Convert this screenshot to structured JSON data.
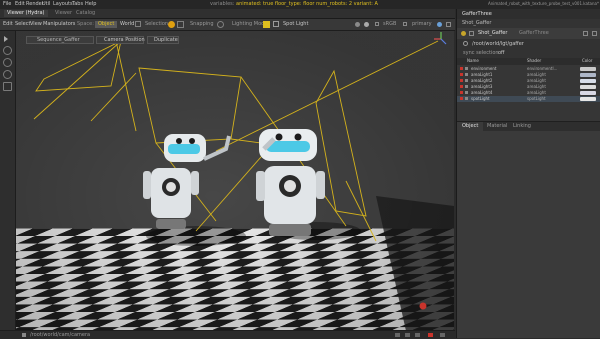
{
  "menubar": {
    "items": [
      "File",
      "Edit",
      "Render",
      "Util",
      "Layouts",
      "Tabs",
      "Help"
    ],
    "status_prefix": "variables:",
    "status_variants": "animated: true  floor_type: floor  num_robots: 2  variant: A",
    "project_file": "Animated_robot_with_texture_probe_test_v001.katana*"
  },
  "tabs": {
    "items": [
      "Viewer (Hydra)",
      "Viewer",
      "Catalog"
    ],
    "active_index": 0
  },
  "toolbar": {
    "items": [
      "Edit",
      "Select",
      "View",
      "Manipulators",
      "Space:"
    ],
    "object_btn": "Object",
    "world_btn": "World",
    "selection_label": "Selection",
    "snapping_label": "Snapping",
    "lighting_label": "Lighting Mode",
    "spot_light": "Spot Light",
    "display_label": "sRGB",
    "camera_label": "primary"
  },
  "viewport_header": {
    "gaffer_field": "Sequence_Gaffer",
    "camera_pos_btn": "Camera Position",
    "duplicate_btn": "Duplicate"
  },
  "status": {
    "camera_path": "/root/world/cam/camera"
  },
  "right_panel": {
    "title": "GafferThree",
    "node_name": "Shot_Gaffer",
    "node_type": "GafferThree",
    "root_path": "/root/world/lgt/gaffer",
    "selection_label": "sync selection",
    "selection_value": "off",
    "columns": [
      "Name",
      "Shader",
      "Color"
    ],
    "rows": [
      {
        "name": "environment",
        "shader": "environmentl...",
        "color": "#c9c9c9"
      },
      {
        "name": "areaLight1",
        "shader": "areaLight",
        "color": "#aeb7c8"
      },
      {
        "name": "areaLight2",
        "shader": "areaLight",
        "color": "#d7dde8"
      },
      {
        "name": "areaLight3",
        "shader": "areaLight",
        "color": "#dcdcdc"
      },
      {
        "name": "areaLight4",
        "shader": "areaLight",
        "color": "#d8d8e4"
      },
      {
        "name": "spotLight",
        "shader": "spotLight",
        "color": "#e6e6e6"
      }
    ],
    "bottom_tabs": [
      "Object",
      "Material",
      "Linking"
    ],
    "active_bottom_tab": 0
  },
  "colors": {
    "accent_yellow": "#e0c020",
    "gizmo_yellow": "#d4b21c",
    "spot_light_red": "#c9342c"
  }
}
